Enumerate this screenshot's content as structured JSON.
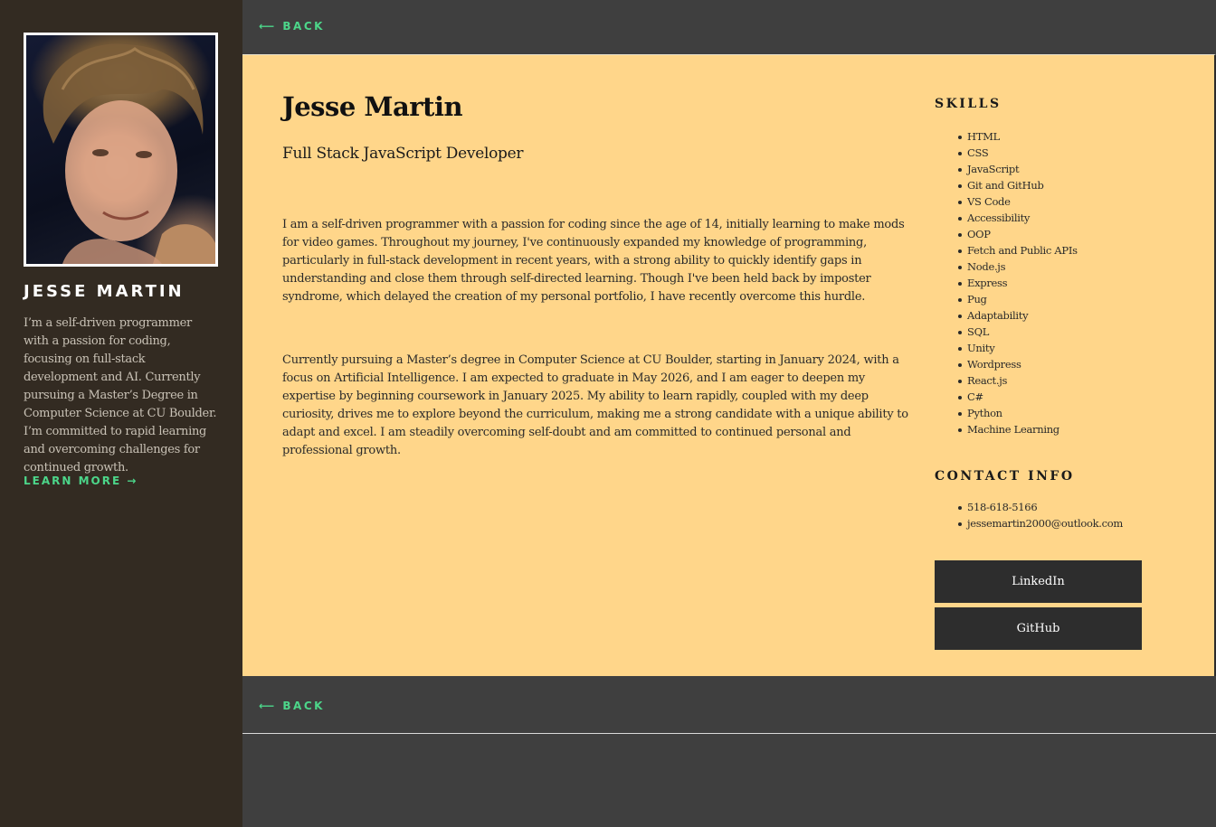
{
  "sidebar": {
    "photo_alt": "Jesse Martin portrait",
    "name": "JESSE MARTIN",
    "bio": "I’m a self-driven programmer with a passion for coding, focusing on full-stack development and AI. Currently pursuing a Master’s Degree in Computer Science at CU Boulder. I’m committed to rapid learning and overcoming challenges for continued growth.",
    "learn_more": "LEARN MORE →"
  },
  "nav": {
    "back_top": "⟵ BACK",
    "back_bottom": "⟵ BACK"
  },
  "main": {
    "title": "Jesse Martin",
    "subtitle": "Full Stack JavaScript Developer",
    "paragraphs": [
      "I am a self-driven programmer with a passion for coding since the age of 14, initially learning to make mods for video games. Throughout my journey, I've continuously expanded my knowledge of programming, particularly in full-stack development in recent years, with a strong ability to quickly identify gaps in understanding and close them through self-directed learning. Though I've been held back by imposter syndrome, which delayed the creation of my personal portfolio, I have recently overcome this hurdle.",
      "Currently pursuing a Master’s degree in Computer Science at CU Boulder, starting in January 2024, with a focus on Artificial Intelligence. I am expected to graduate in May 2026, and I am eager to deepen my expertise by beginning coursework in January 2025. My ability to learn rapidly, coupled with my deep curiosity, drives me to explore beyond the curriculum, making me a strong candidate with a unique ability to adapt and excel. I am steadily overcoming self-doubt and am committed to continued personal and professional growth."
    ]
  },
  "skills": {
    "heading": "SKILLS",
    "items": [
      "HTML",
      "CSS",
      "JavaScript",
      "Git and GitHub",
      "VS Code",
      "Accessibility",
      "OOP",
      "Fetch and Public APIs",
      "Node.js",
      "Express",
      "Pug",
      "Adaptability",
      "SQL",
      "Unity",
      "Wordpress",
      "React.js",
      "C#",
      "Python",
      "Machine Learning"
    ]
  },
  "contact": {
    "heading": "CONTACT INFO",
    "items": [
      "518-618-5166",
      "jessemartin2000@outlook.com"
    ]
  },
  "buttons": {
    "linkedin": "LinkedIn",
    "github": "GitHub"
  },
  "colors": {
    "sidebar_bg": "#332b22",
    "page_bg": "#3f3f3f",
    "card_bg": "#ffd68a",
    "accent_green": "#4cd68a",
    "button_bg": "#2d2d2d"
  }
}
